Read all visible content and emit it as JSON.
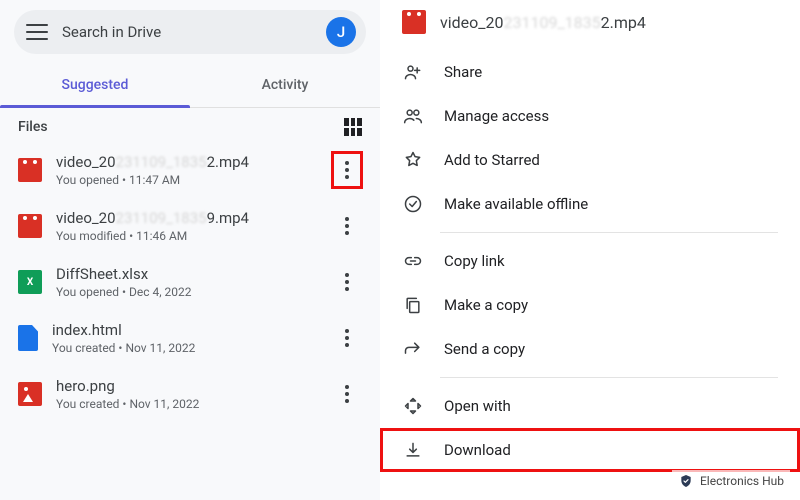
{
  "search": {
    "placeholder": "Search in Drive",
    "avatar_initial": "J"
  },
  "tabs": {
    "suggested": "Suggested",
    "activity": "Activity"
  },
  "files_section": {
    "label": "Files"
  },
  "files": [
    {
      "name_prefix": "video_20",
      "name_blur": "231109_1835",
      "name_suffix": "2.mp4",
      "meta": "You opened • 11:47 AM",
      "icon": "video",
      "highlighted_more": true
    },
    {
      "name_prefix": "video_20",
      "name_blur": "231109_1835",
      "name_suffix": "9.mp4",
      "meta": "You modified • 11:46 AM",
      "icon": "video",
      "highlighted_more": false
    },
    {
      "name_prefix": "DiffSheet.xlsx",
      "name_blur": "",
      "name_suffix": "",
      "meta": "You opened • Dec 4, 2022",
      "icon": "xlsx",
      "highlighted_more": false
    },
    {
      "name_prefix": "index.html",
      "name_blur": "",
      "name_suffix": "",
      "meta": "You created • Nov 11, 2022",
      "icon": "html",
      "highlighted_more": false
    },
    {
      "name_prefix": "hero.png",
      "name_blur": "",
      "name_suffix": "",
      "meta": "You created • Nov 11, 2022",
      "icon": "image",
      "highlighted_more": false
    }
  ],
  "context": {
    "file": {
      "name_prefix": "video_20",
      "name_blur": "231109_1835",
      "name_suffix": "2.mp4"
    },
    "items": {
      "share": "Share",
      "manage_access": "Manage access",
      "add_starred": "Add to Starred",
      "offline": "Make available offline",
      "copy_link": "Copy link",
      "make_copy": "Make a copy",
      "send_copy": "Send a copy",
      "open_with": "Open with",
      "download": "Download"
    }
  },
  "watermark": "Electronics Hub"
}
